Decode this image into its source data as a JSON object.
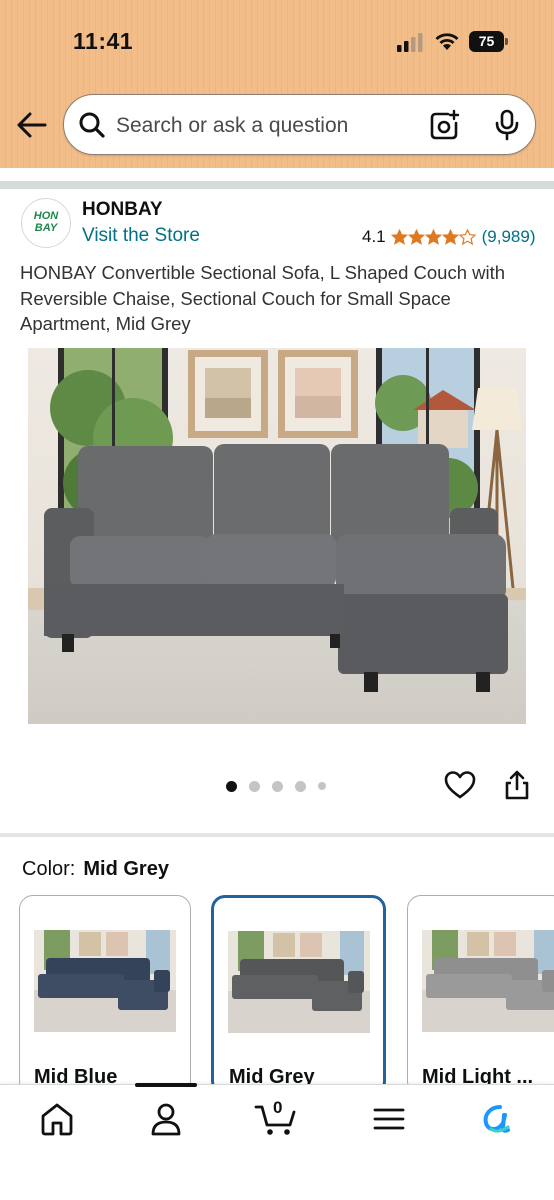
{
  "status_bar": {
    "time": "11:41",
    "battery": "75"
  },
  "search": {
    "placeholder": "Search or ask a question"
  },
  "store": {
    "brand": "HONBAY",
    "logo_text_line1": "HON",
    "logo_text_line2": "BAY",
    "visit_label": "Visit the Store",
    "rating": "4.1",
    "stars_filled": 4,
    "stars_total": 5,
    "review_count": "(9,989)"
  },
  "product": {
    "title": "HONBAY Convertible Sectional Sofa, L Shaped Couch with Reversible Chaise, Sectional Couch for Small Space Apartment, Mid Grey",
    "image_count": 5,
    "active_image": 1
  },
  "color": {
    "label": "Color:",
    "selected": "Mid Grey",
    "options": [
      {
        "label": "Mid Blue",
        "swatch": "#3e4d63"
      },
      {
        "label": "Mid Grey",
        "swatch": "#5f6062"
      },
      {
        "label": "Mid Light ...",
        "swatch": "#9a9a9a"
      }
    ]
  },
  "colors": {
    "accent_link": "#007185",
    "star": "#de7921",
    "selected_border": "#2162a1",
    "header_bg": "#f3bd8a",
    "alexa_icon": "#1a98ff"
  },
  "nav": {
    "items": [
      "home-icon",
      "account-icon",
      "cart-icon",
      "menu-icon",
      "rufus-ai-icon"
    ],
    "cart_count": "0"
  }
}
